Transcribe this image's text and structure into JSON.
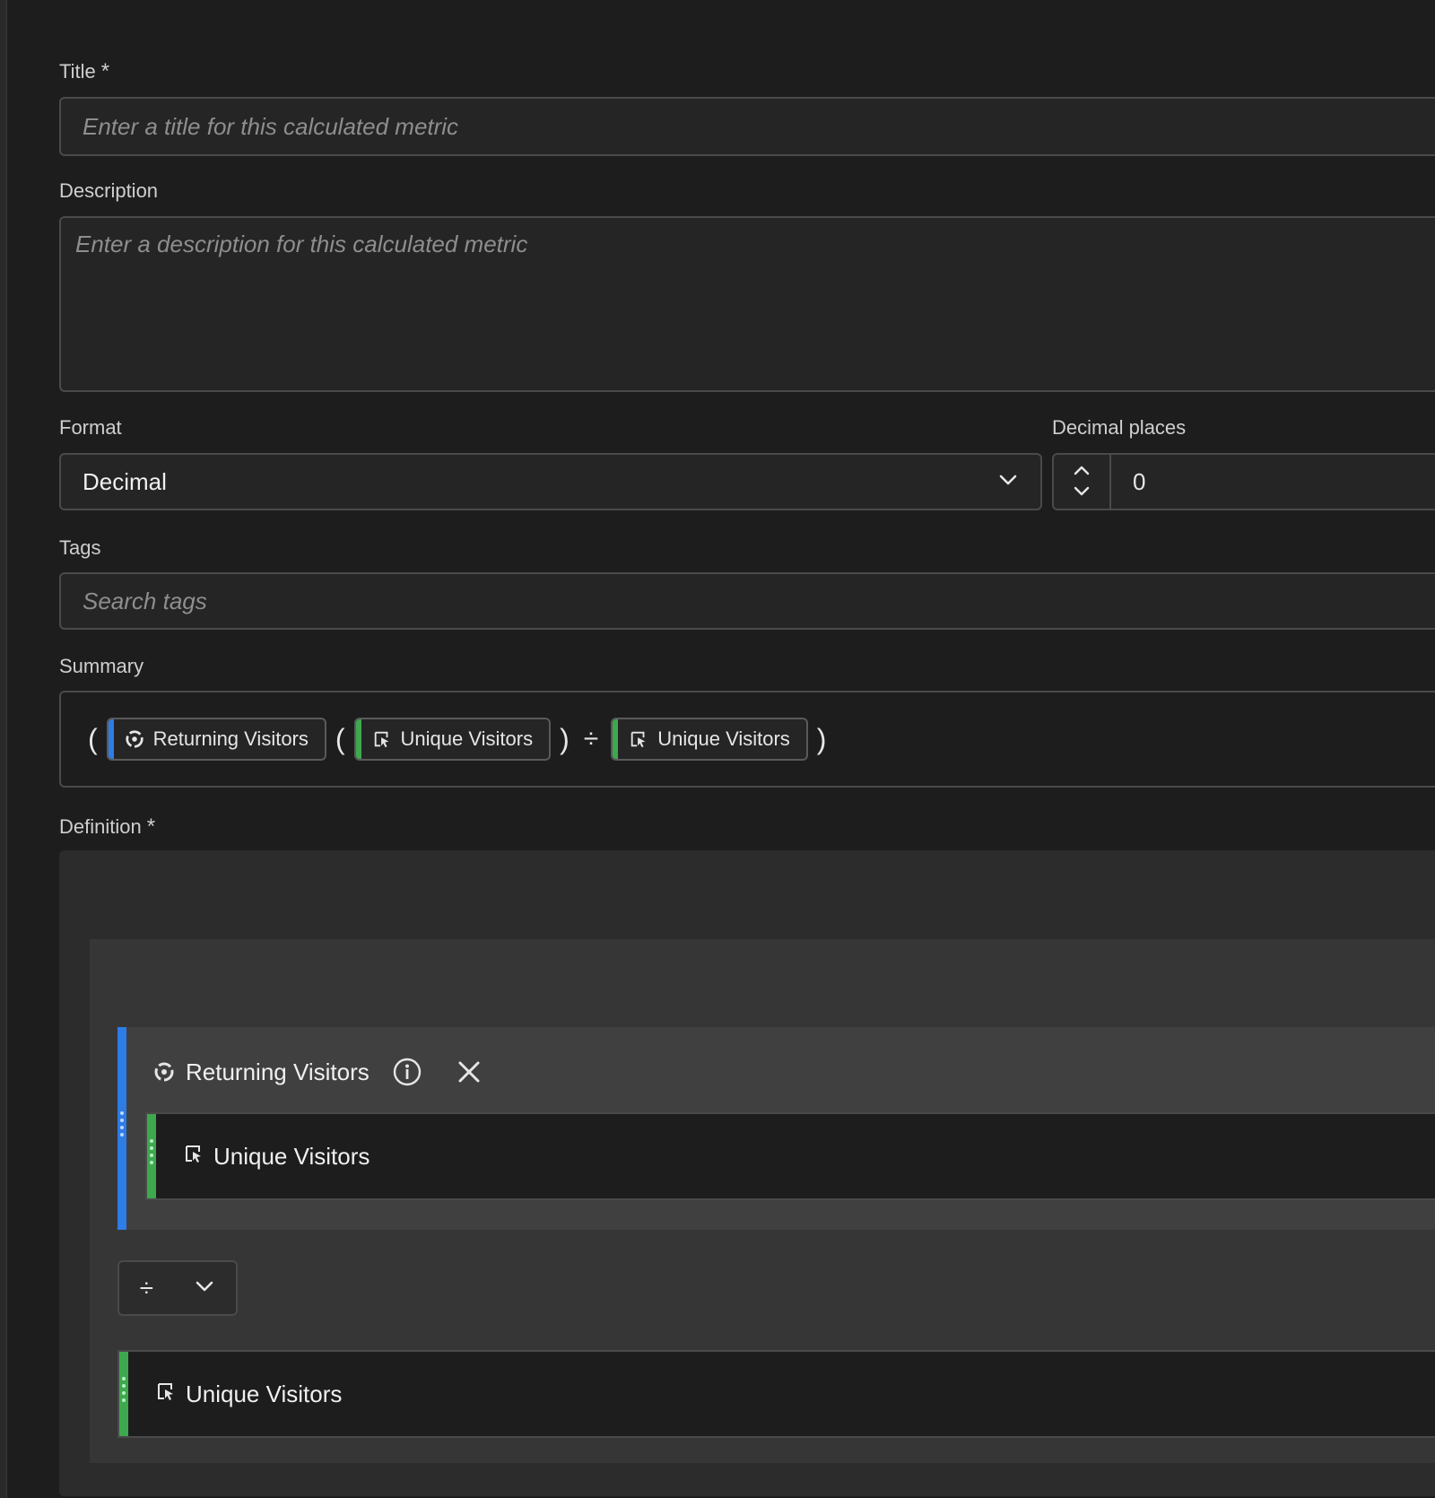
{
  "title_field": {
    "label": "Title",
    "required_mark": "*",
    "placeholder": "Enter a title for this calculated metric"
  },
  "description_field": {
    "label": "Description",
    "placeholder": "Enter a description for this calculated metric"
  },
  "format_field": {
    "label": "Format",
    "value": "Decimal"
  },
  "decimal_field": {
    "label": "Decimal places",
    "value": "0"
  },
  "tags_field": {
    "label": "Tags",
    "placeholder": "Search tags"
  },
  "summary": {
    "label": "Summary",
    "open_paren": "(",
    "close_paren": ")",
    "divide": "÷",
    "segment_chip": "Returning Visitors",
    "metric_chip_1": "Unique Visitors",
    "metric_chip_2": "Unique Visitors"
  },
  "definition": {
    "label": "Definition",
    "required_mark": "*",
    "group_name": "Returning Visitors",
    "inner_metric": "Unique Visitors",
    "operator": "÷",
    "outer_metric": "Unique Visitors"
  },
  "colors": {
    "segment_accent": "#2e7ce6",
    "metric_accent": "#3ea84f"
  }
}
